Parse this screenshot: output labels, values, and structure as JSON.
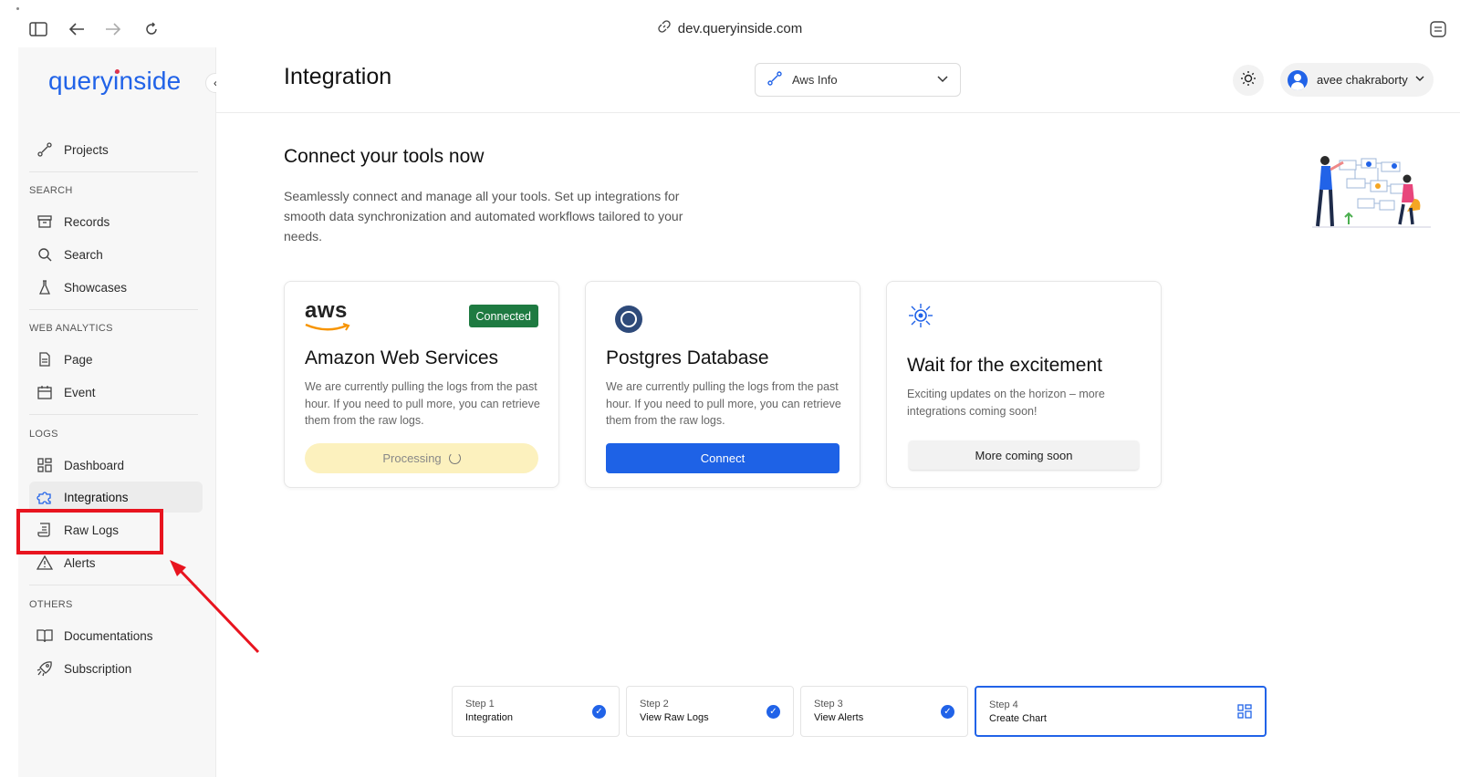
{
  "browser": {
    "url": "dev.queryinside.com"
  },
  "sidebar": {
    "logo": "queryinside",
    "projects_label": "Projects",
    "sections": {
      "search": "SEARCH",
      "web_analytics": "WEB ANALYTICS",
      "logs": "LOGS",
      "others": "OTHERS"
    },
    "items": {
      "records": "Records",
      "search": "Search",
      "showcases": "Showcases",
      "page": "Page",
      "event": "Event",
      "dashboard": "Dashboard",
      "integrations": "Integrations",
      "raw_logs": "Raw Logs",
      "alerts": "Alerts",
      "documentations": "Documentations",
      "subscription": "Subscription"
    }
  },
  "header": {
    "title": "Integration",
    "project_select": "Aws Info",
    "user_name": "avee chakraborty"
  },
  "main": {
    "title": "Connect your tools now",
    "description": "Seamlessly connect and manage all your tools. Set up integrations for smooth data synchronization and automated workflows tailored to your needs."
  },
  "cards": [
    {
      "logo_text": "aws",
      "badge": "Connected",
      "title": "Amazon Web Services",
      "description": "We are currently pulling the logs from the past hour. If you need to pull more, you can retrieve them from the raw logs.",
      "button": "Processing"
    },
    {
      "title": "Postgres Database",
      "description": "We are currently pulling the logs from the past hour. If you need to pull more, you can retrieve them from the raw logs.",
      "button": "Connect"
    },
    {
      "title": "Wait for the excitement",
      "description": "Exciting updates on the horizon – more integrations coming soon!",
      "button": "More coming soon"
    }
  ],
  "steps": [
    {
      "number": "Step 1",
      "name": "Integration",
      "done": true
    },
    {
      "number": "Step 2",
      "name": "View Raw Logs",
      "done": true
    },
    {
      "number": "Step 3",
      "name": "View Alerts",
      "done": true
    },
    {
      "number": "Step 4",
      "name": "Create Chart",
      "done": false
    }
  ],
  "colors": {
    "accent": "#2163e8",
    "connected_badge": "#1e7a41",
    "processing_bg": "#fcf1be",
    "annotation_red": "#e8141f"
  }
}
